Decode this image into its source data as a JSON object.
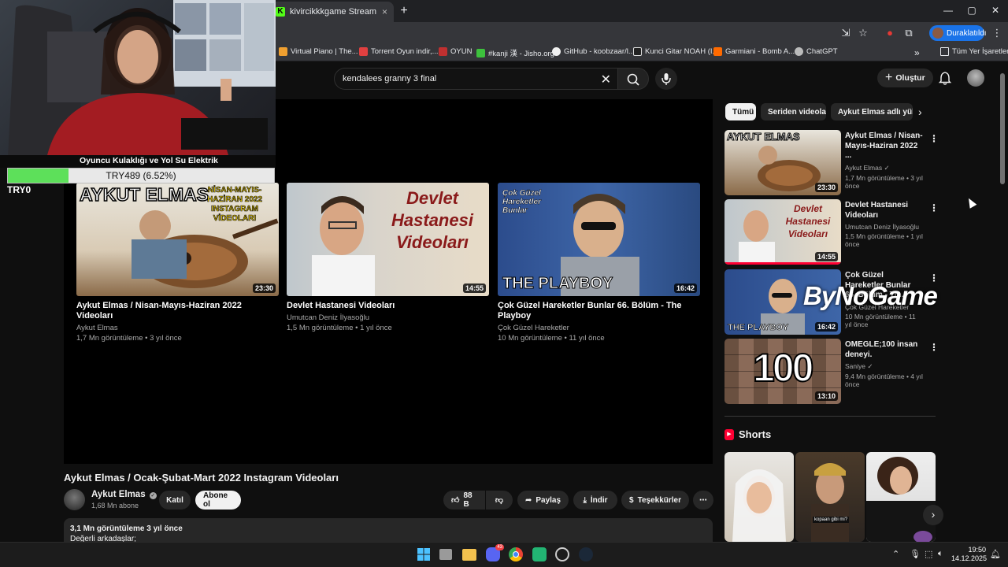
{
  "browser": {
    "tab_title": "kivircikkkgame Stream - Watch",
    "tab_close": "×",
    "new_tab": "+",
    "tab_favicon": "K",
    "profile_label": "Duraklatıldı",
    "window_controls": [
      "—",
      "▢",
      "✕"
    ]
  },
  "bookmarks": {
    "items": [
      {
        "label": "Virtual Piano | The...",
        "color": "#f0a030"
      },
      {
        "label": "Torrent Oyun indir,...",
        "color": "#e04040"
      },
      {
        "label": "OYUN",
        "color": "#c03030"
      },
      {
        "label": "#kanji 漢 - Jisho.org",
        "color": "#3dc23d"
      },
      {
        "label": "GitHub - koobzaar/l...",
        "color": "#f1f1f1"
      },
      {
        "label": "Kunci Gitar NOAH (I...",
        "color": "#222222"
      },
      {
        "label": "Garmiani - Bomb A...",
        "color": "#ff6a00"
      },
      {
        "label": "ChatGPT",
        "color": "#bbbbbb"
      }
    ],
    "more": "»",
    "all_bookmarks": "Tüm Yer İşaretleri"
  },
  "header": {
    "search_value": "kendalees granny 3 final",
    "create_label": "Oluştur"
  },
  "stream_overlay": {
    "overlay_text": "Oyuncu Kulaklığı ve Yol Su Elektrik",
    "donation_label": "TRY489 (6.52%)",
    "donation_progress": 0.0652,
    "left_label": "TRY0"
  },
  "end_cards": [
    {
      "title": "Aykut Elmas / Nisan-Mayıs-Haziran 2022 Videoları",
      "channel": "Aykut Elmas",
      "meta": "1,7 Mn görüntüleme • 3 yıl önce",
      "duration": "23:30",
      "thumb_text": "AYKUT ELMAS",
      "thumb_sub": "NİSAN-MAYIS-HAZİRAN 2022 INSTAGRAM VİDEOLARI"
    },
    {
      "title": "Devlet Hastanesi Videoları",
      "channel": "Umutcan Deniz İlyasoğlu",
      "meta": "1,5 Mn görüntüleme • 1 yıl önce",
      "duration": "14:55",
      "thumb_text": "Devlet Hastanesi Videoları"
    },
    {
      "title": "Çok Güzel Hareketler Bunlar 66. Bölüm - The Playboy",
      "channel": "Çok Güzel Hareketler",
      "meta": "10 Mn görüntüleme • 11 yıl önce",
      "duration": "16:42",
      "thumb_text": "THE PLAYBOY",
      "thumb_logo": "Çok Güzel Hareketler Bunlar"
    }
  ],
  "video": {
    "title": "Aykut Elmas / Ocak-Şubat-Mart 2022 Instagram Videoları",
    "channel": "Aykut Elmas",
    "subs": "1,68 Mn abone",
    "join_label": "Katıl",
    "subscribe_label": "Abone ol",
    "like_count": "88 B",
    "share_label": "Paylaş",
    "download_label": "İndir",
    "thanks_label": "Teşekkürler",
    "views_line": "3,1 Mn görüntüleme  3 yıl önce",
    "desc_line": "Değerli arkadaşlar;"
  },
  "chips": [
    "Tümü",
    "Seriden videolar",
    "Aykut Elmas adlı yükl"
  ],
  "sidebar": [
    {
      "title": "Aykut Elmas / Nisan-Mayıs-Haziran 2022 ...",
      "channel": "Aykut Elmas",
      "meta": "1,7 Mn görüntüleme • 3 yıl önce",
      "duration": "23:30",
      "thumb_text": "AYKUT ELMAS"
    },
    {
      "title": "Devlet Hastanesi Videoları",
      "channel": "Umutcan Deniz İlyasoğlu",
      "meta": "1,5 Mn görüntüleme • 1 yıl önce",
      "duration": "14:55",
      "thumb_text": "Devlet Hastanesi Videoları"
    },
    {
      "title": "Çok Güzel Hareketler Bunlar 66. Bölüm - Th...",
      "channel": "Çok Güzel Hareketler",
      "meta": "10 Mn görüntüleme • 11 yıl önce",
      "duration": "16:42",
      "thumb_text": "THE PLAYBOY"
    },
    {
      "title": "OMEGLE;100 insan deneyi.",
      "channel": "Saniye",
      "meta": "9,4 Mn görüntüleme • 4 yıl önce",
      "duration": "13:10",
      "thumb_text": "100"
    }
  ],
  "watermark": "ByNoGame",
  "shorts_heading": "Shorts",
  "short_caption": "kopaan gibi mi?",
  "taskbar": {
    "time": "19:50",
    "date": "14.12.2025",
    "discord_badge": "43"
  },
  "colors": {
    "background": "#0f0f0f",
    "accent_red": "#ff0033",
    "profile_blue": "#1a73e8",
    "donation_green": "#5de05a",
    "kick_green": "#53fc18"
  }
}
